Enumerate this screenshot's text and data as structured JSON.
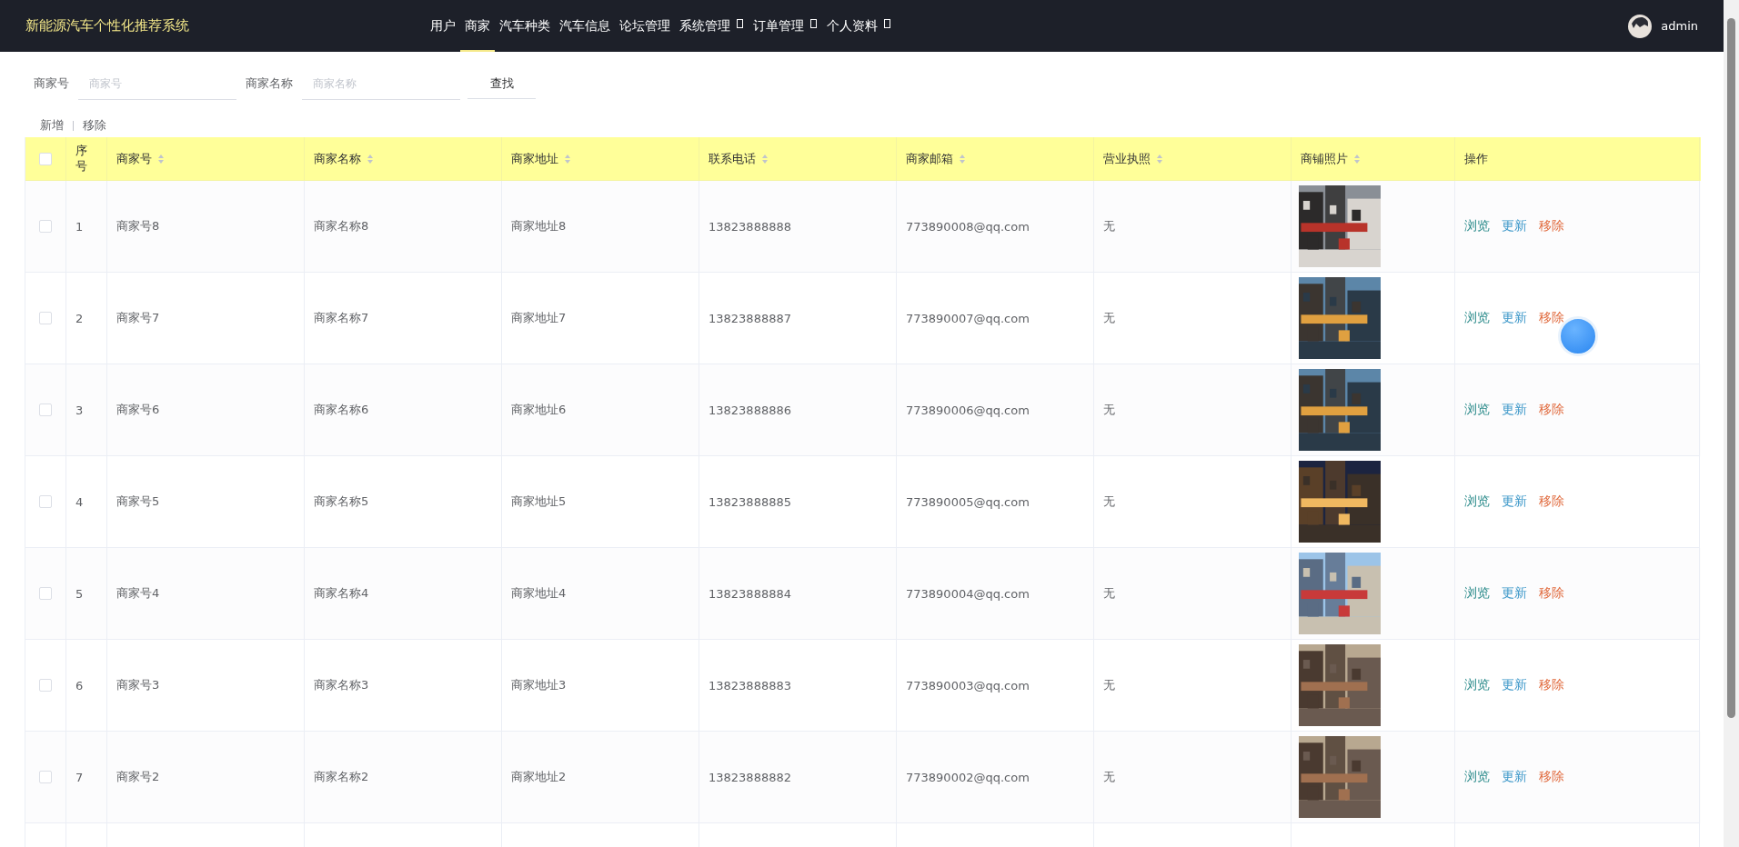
{
  "header": {
    "title": "新能源汽车个性化推荐系统",
    "nav": [
      {
        "label": "用户",
        "selected": false,
        "dropdown": false
      },
      {
        "label": "商家",
        "selected": true,
        "dropdown": false
      },
      {
        "label": "汽车种类",
        "selected": false,
        "dropdown": false
      },
      {
        "label": "汽车信息",
        "selected": false,
        "dropdown": false
      },
      {
        "label": "论坛管理",
        "selected": false,
        "dropdown": false
      },
      {
        "label": "系统管理",
        "selected": false,
        "dropdown": true
      },
      {
        "label": "订单管理",
        "selected": false,
        "dropdown": true
      },
      {
        "label": "个人资料",
        "selected": false,
        "dropdown": true
      }
    ],
    "user": "admin"
  },
  "search": {
    "fields": [
      {
        "label": "商家号",
        "placeholder": "商家号"
      },
      {
        "label": "商家名称",
        "placeholder": "商家名称"
      }
    ],
    "button": "查找"
  },
  "actions": [
    "新增",
    "移除"
  ],
  "table": {
    "select_all": {
      "checked": false
    },
    "columns": [
      {
        "label": "序号",
        "sortable": false
      },
      {
        "label": "商家号",
        "sortable": true
      },
      {
        "label": "商家名称",
        "sortable": true
      },
      {
        "label": "商家地址",
        "sortable": true
      },
      {
        "label": "联系电话",
        "sortable": true
      },
      {
        "label": "商家邮箱",
        "sortable": true
      },
      {
        "label": "营业执照",
        "sortable": true
      },
      {
        "label": "商铺照片",
        "sortable": true
      },
      {
        "label": "操作",
        "sortable": false
      }
    ],
    "rows": [
      {
        "checked": false,
        "cells": [
          "1",
          "商家号8",
          "商家名称8",
          "商家地址8",
          "13823888888",
          "773890008@qq.com",
          "无"
        ],
        "photo": {
          "kind": "picture"
        },
        "actions": [
          {
            "label": "浏览",
            "color": "#2a8a8a"
          },
          {
            "label": "更新",
            "color": "#3a96c8"
          },
          {
            "label": "移除",
            "color": "#e0693c"
          }
        ]
      },
      {
        "checked": false,
        "cells": [
          "2",
          "商家号7",
          "商家名称7",
          "商家地址7",
          "13823888887",
          "773890007@qq.com",
          "无"
        ],
        "photo": {
          "kind": "picture"
        },
        "actions": [
          {
            "label": "浏览",
            "color": "#2a8a8a"
          },
          {
            "label": "更新",
            "color": "#3a96c8"
          },
          {
            "label": "移除",
            "color": "#e0693c"
          }
        ]
      },
      {
        "checked": false,
        "cells": [
          "3",
          "商家号6",
          "商家名称6",
          "商家地址6",
          "13823888886",
          "773890006@qq.com",
          "无"
        ],
        "photo": {
          "kind": "picture"
        },
        "actions": [
          {
            "label": "浏览",
            "color": "#2a8a8a"
          },
          {
            "label": "更新",
            "color": "#3a96c8"
          },
          {
            "label": "移除",
            "color": "#e0693c"
          }
        ]
      },
      {
        "checked": false,
        "cells": [
          "4",
          "商家号5",
          "商家名称5",
          "商家地址5",
          "13823888885",
          "773890005@qq.com",
          "无"
        ],
        "photo": {
          "kind": "picture"
        },
        "actions": [
          {
            "label": "浏览",
            "color": "#2a8a8a"
          },
          {
            "label": "更新",
            "color": "#3a96c8"
          },
          {
            "label": "移除",
            "color": "#e0693c"
          }
        ]
      },
      {
        "checked": false,
        "cells": [
          "5",
          "商家号4",
          "商家名称4",
          "商家地址4",
          "13823888884",
          "773890004@qq.com",
          "无"
        ],
        "photo": {
          "kind": "picture"
        },
        "actions": [
          {
            "label": "浏览",
            "color": "#2a8a8a"
          },
          {
            "label": "更新",
            "color": "#3a96c8"
          },
          {
            "label": "移除",
            "color": "#e0693c"
          }
        ]
      },
      {
        "checked": false,
        "cells": [
          "6",
          "商家号3",
          "商家名称3",
          "商家地址3",
          "13823888883",
          "773890003@qq.com",
          "无"
        ],
        "photo": {
          "kind": "picture"
        },
        "actions": [
          {
            "label": "浏览",
            "color": "#2a8a8a"
          },
          {
            "label": "更新",
            "color": "#3a96c8"
          },
          {
            "label": "移除",
            "color": "#e0693c"
          }
        ]
      },
      {
        "checked": false,
        "cells": [
          "7",
          "商家号2",
          "商家名称2",
          "商家地址2",
          "13823888882",
          "773890002@qq.com",
          "无"
        ],
        "photo": {
          "kind": "picture"
        },
        "actions": [
          {
            "label": "浏览",
            "color": "#2a8a8a"
          },
          {
            "label": "更新",
            "color": "#3a96c8"
          },
          {
            "label": "移除",
            "color": "#e0693c"
          }
        ]
      }
    ]
  }
}
